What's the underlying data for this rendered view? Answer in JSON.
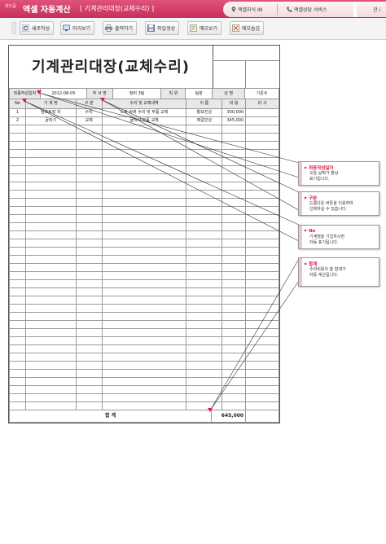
{
  "app": {
    "brand_small": "에즈폼",
    "brand": "엑셀 자동계산",
    "doc_title": "[ 기계관리대장(교체수리) ]",
    "top_tabs": [
      {
        "label": "엑셀지식 IN",
        "icon": "location-pin-icon"
      },
      {
        "label": "엑셀상담 서비스",
        "icon": "phone-icon"
      }
    ],
    "cut_text": "관 i"
  },
  "toolbar": {
    "buttons": [
      {
        "label": "새로작성",
        "icon": "refresh-icon"
      },
      {
        "label": "미리보기",
        "icon": "monitor-icon"
      },
      {
        "label": "출력하기",
        "icon": "printer-icon"
      },
      {
        "label": "파일생성",
        "icon": "save-icon"
      },
      {
        "label": "메모보기",
        "icon": "memo-icon"
      },
      {
        "label": "메모숨김",
        "icon": "memo-hide-icon"
      }
    ]
  },
  "sheet": {
    "title": "기계관리대장(교체수리)",
    "info": {
      "date_label": "최종작성일자",
      "date_value": "2012-08-05",
      "dept_label": "부 서 명",
      "dept_value": "정비 3팀",
      "position_label": "직   위",
      "position_value": "팀장",
      "name_label": "성   명",
      "name_value": "기준수"
    },
    "headers": [
      "No",
      "기 계 명",
      "구  분",
      "수리 및 교체내역",
      "이  름",
      "비  용",
      "비  고"
    ],
    "rows": [
      {
        "no": "1",
        "machine": "덤프트럭 차",
        "type": "수리",
        "detail": "노후 바퀴 수리 및 부품 교체",
        "name": "황보진성",
        "cost": "300,000",
        "note": ""
      },
      {
        "no": "2",
        "machine": "굴착기",
        "type": "교체",
        "detail": "굴착기 부품 교체",
        "name": "제갈민성",
        "cost": "345,000",
        "note": ""
      }
    ],
    "total_label": "합     계",
    "total_value": "645,000"
  },
  "callouts": [
    {
      "title": "최종작성일자",
      "body": "오늘 날짜가 항상\n표기됩니다."
    },
    {
      "title": "구분",
      "body": "드롭다운 버튼을 이용하여\n선택하실 수 있습니다."
    },
    {
      "title": "No",
      "body": "기계명을 기입하시면\n자동 표기됩니다."
    },
    {
      "title": "합계",
      "body": "수리비용의 총 합계가\n자동 계산됩니다."
    }
  ],
  "colors": {
    "topbar": "#d23f68",
    "callout_title": "#d8163f",
    "marker": "#e01a3a"
  }
}
